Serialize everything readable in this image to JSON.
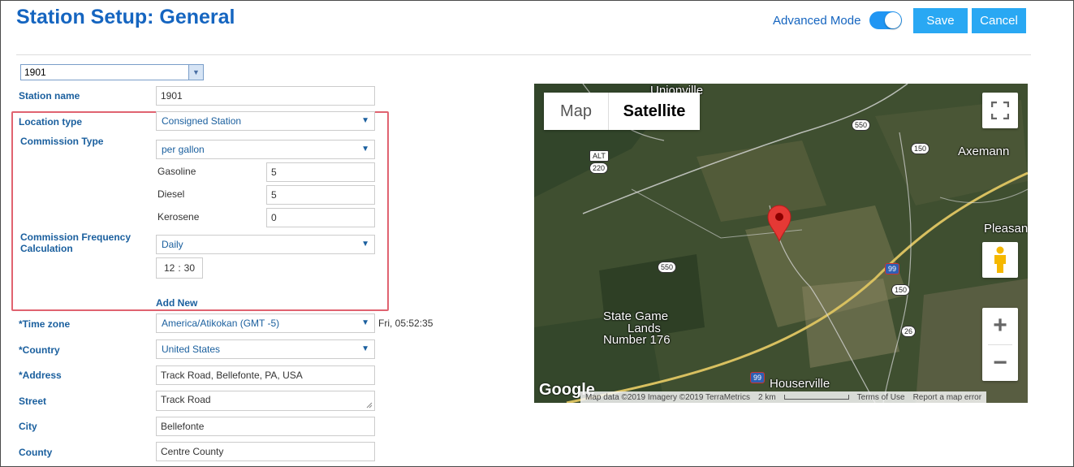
{
  "header": {
    "title": "Station Setup: General",
    "advanced_mode_label": "Advanced Mode",
    "advanced_mode_on": true,
    "save_label": "Save",
    "cancel_label": "Cancel"
  },
  "station_selector": {
    "value": "1901"
  },
  "form": {
    "station_name": {
      "label": "Station name",
      "value": "1901"
    },
    "location_type": {
      "label": "Location type",
      "value": "Consigned Station"
    },
    "commission_type": {
      "label": "Commission Type",
      "value": "per gallon",
      "fuels": [
        {
          "label": "Gasoline",
          "value": "5"
        },
        {
          "label": "Diesel",
          "value": "5"
        },
        {
          "label": "Kerosene",
          "value": "0"
        }
      ]
    },
    "commission_frequency": {
      "label_line1": "Commission Frequency",
      "label_line2": "Calculation",
      "value": "Daily",
      "time_hour": "12",
      "time_sep": ":",
      "time_minute": "30"
    },
    "add_new_label": "Add New",
    "time_zone": {
      "label": "*Time zone",
      "value": "America/Atikokan (GMT -5)",
      "current_time": "Fri, 05:52:35"
    },
    "country": {
      "label": "*Country",
      "value": "United States"
    },
    "address": {
      "label": "*Address",
      "value": "Track Road, Bellefonte, PA, USA"
    },
    "street": {
      "label": "Street",
      "value": "Track Road"
    },
    "city": {
      "label": "City",
      "value": "Bellefonte"
    },
    "county": {
      "label": "County",
      "value": "Centre County"
    }
  },
  "map": {
    "tab_map": "Map",
    "tab_satellite": "Satellite",
    "active_tab": "Satellite",
    "places": [
      "Unionville",
      "Axemann",
      "Pleasant",
      "State Game",
      "Lands",
      "Number 176",
      "Houserville"
    ],
    "route_shields": [
      "550",
      "150",
      "ALT",
      "220",
      "550",
      "150",
      "26",
      "99",
      "99"
    ],
    "logo": "Google",
    "attribution": "Map data ©2019 Imagery ©2019 TerraMetrics",
    "scale_label": "2 km",
    "terms_label": "Terms of Use",
    "report_label": "Report a map error",
    "zoom_in": "+",
    "zoom_out": "−",
    "accent_color": "#29a8f3",
    "marker_color": "#e53935"
  }
}
